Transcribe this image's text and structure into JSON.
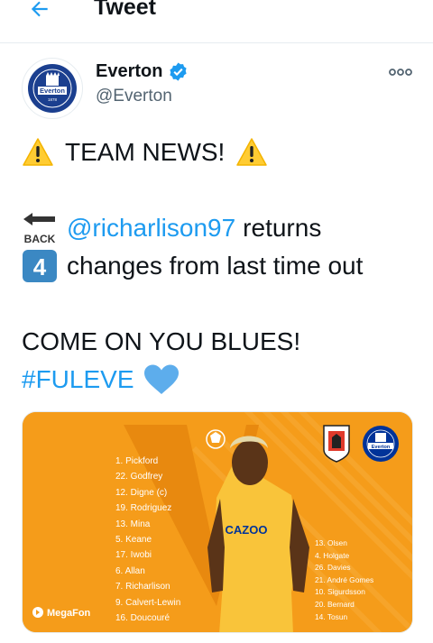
{
  "header": {
    "title": "Tweet",
    "back_icon": "back-arrow-icon"
  },
  "author": {
    "display_name": "Everton",
    "handle": "@Everton",
    "verified_icon": "verified-badge-icon",
    "avatar_text": "Everton",
    "avatar_year": "1878"
  },
  "tweet": {
    "line1_text": "TEAM NEWS!",
    "mention": "@richarlison97",
    "returns_text": "returns",
    "back_emoji_text": "BACK",
    "keycap_number": "4",
    "changes_text": "changes from last time out",
    "come_on_text": "COME ON YOU BLUES!",
    "hashtag": "#FULEVE"
  },
  "media": {
    "lineup_left": [
      "1. Pickford",
      "22. Godfrey",
      "12. Digne (c)",
      "19. Rodriguez",
      "13. Mina",
      "5. Keane",
      "17. Iwobi",
      "6. Allan",
      "7. Richarlison",
      "9. Calvert-Lewin",
      "16. Doucouré"
    ],
    "lineup_right": [
      "13. Olsen",
      "4. Holgate",
      "26. Davies",
      "21. André Gomes",
      "10. Sigurdsson",
      "20. Bernard",
      "14. Tosun"
    ],
    "sponsor": "MegaFon",
    "shirt_sponsor": "CAZOO",
    "crest_text": "Everton",
    "colors": {
      "orange": "#f59c1a",
      "stripe": "#e8890f",
      "blue": "#003399"
    }
  },
  "colors": {
    "link": "#1d9bf0",
    "text": "#0f1419",
    "secondary": "#536471"
  }
}
